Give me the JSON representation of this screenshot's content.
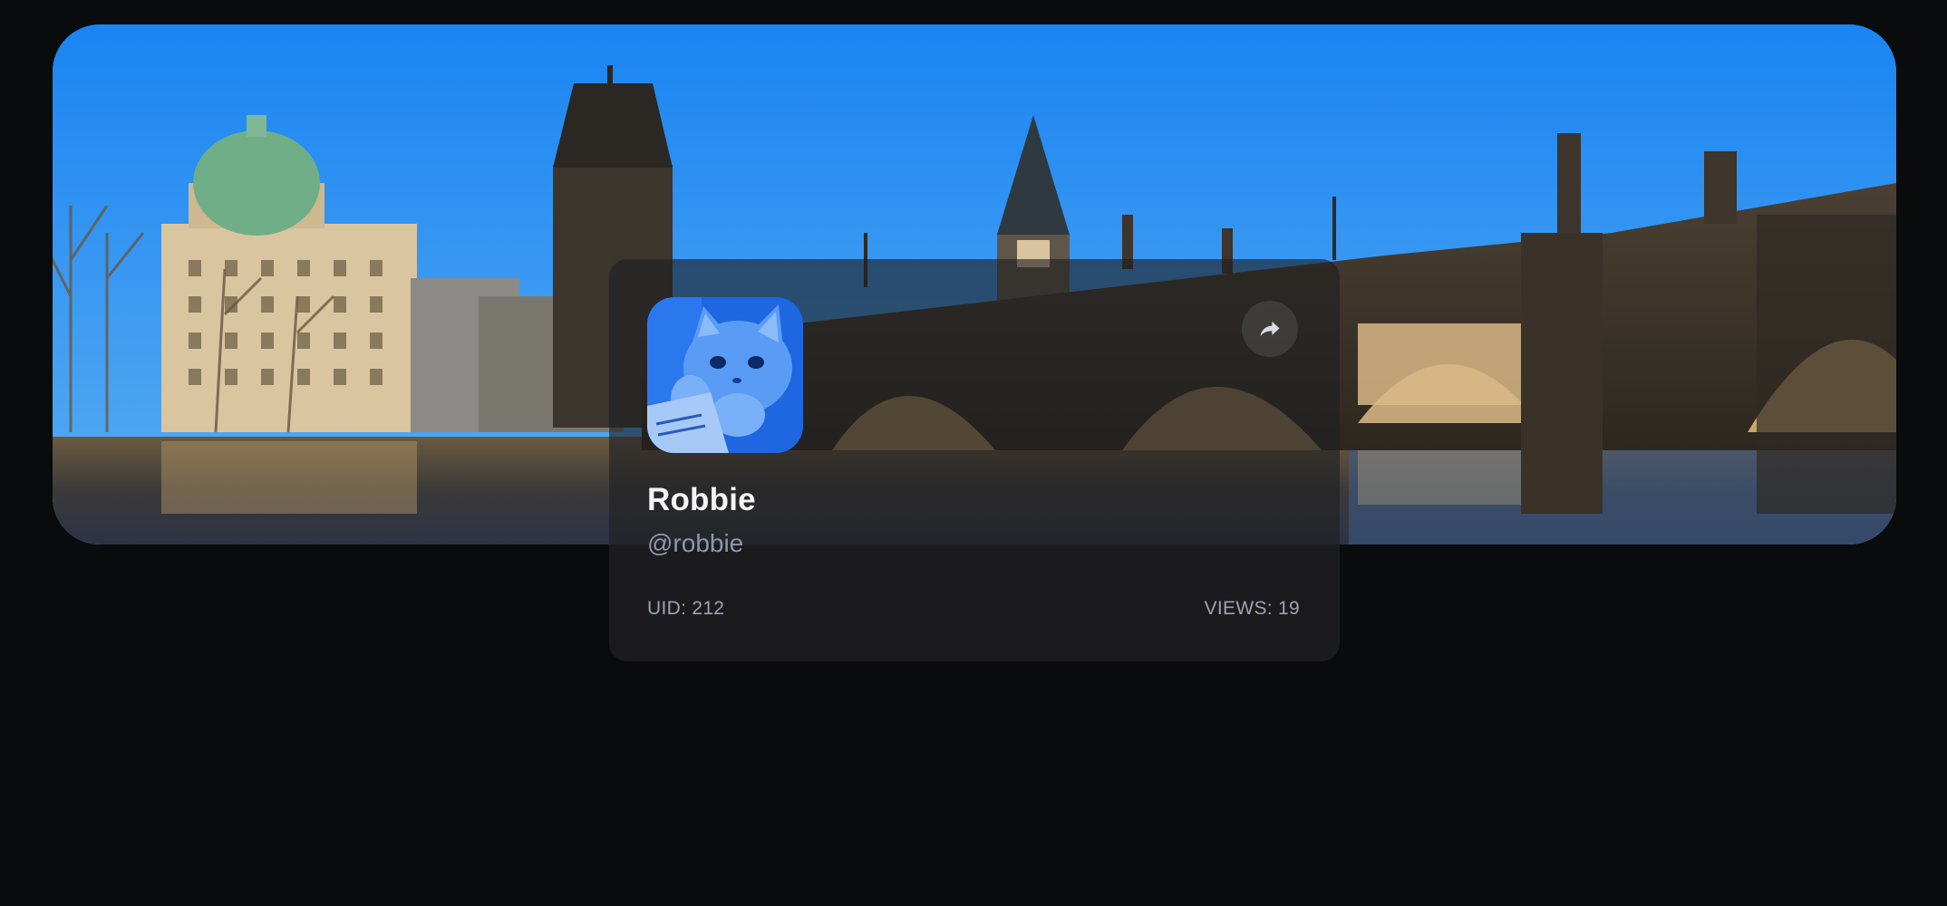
{
  "banner": {
    "description_icon": "city-bridge-banner"
  },
  "profile": {
    "display_name": "Robbie",
    "handle": "@robbie",
    "avatar_icon": "cat-avatar",
    "share_icon": "share-icon",
    "uid_label": "UID: 212",
    "views_label": "VIEWS: 19"
  },
  "colors": {
    "background": "#0a0b0d",
    "card": "#1b1b1e",
    "name_text": "#f4f4f6",
    "muted_text": "#8d97a8"
  }
}
